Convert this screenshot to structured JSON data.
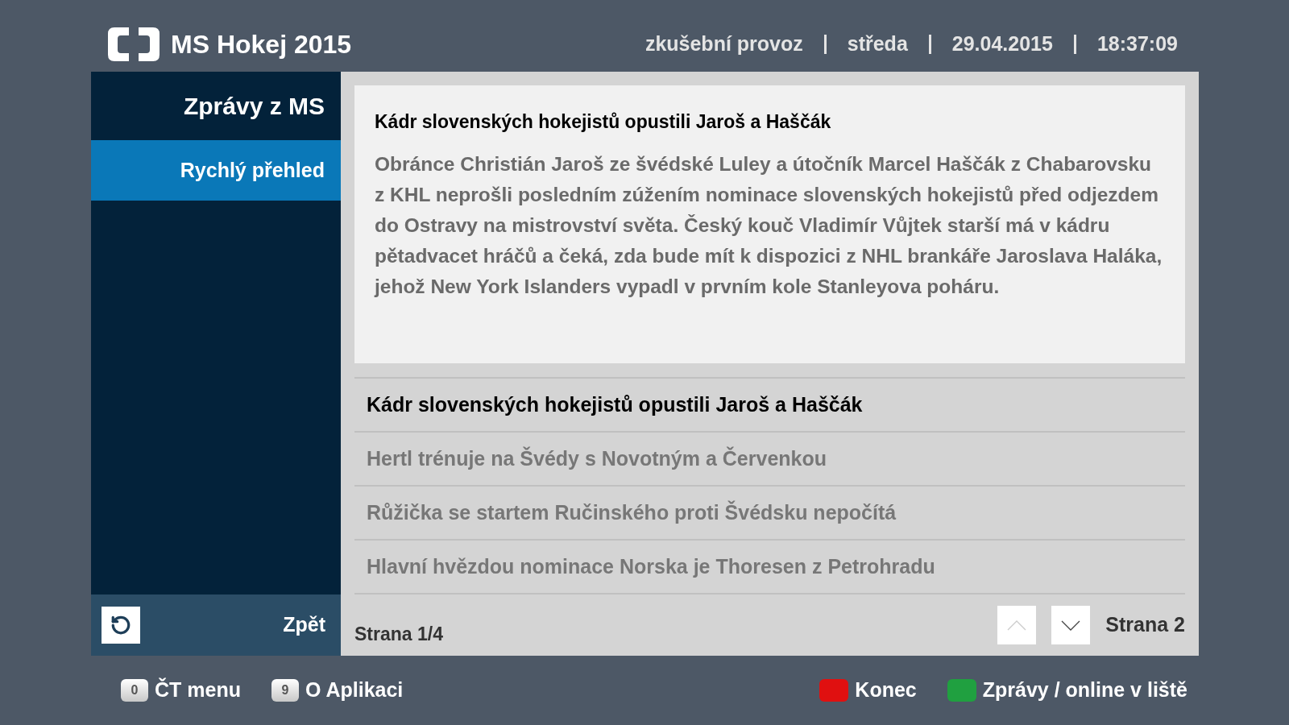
{
  "header": {
    "title": "MS Hokej 2015",
    "status": [
      "zkušební provoz",
      "středa",
      "29.04.2015",
      "18:37:09"
    ]
  },
  "sidebar": {
    "title": "Zprávy z MS",
    "items": [
      {
        "label": "Rychlý přehled",
        "selected": true
      }
    ],
    "back": {
      "label": "Zpět"
    }
  },
  "article": {
    "title": "Kádr slovenských hokejistů opustili Jaroš a Haščák",
    "body": "Obránce Christián Jaroš ze švédské Luley a útočník Marcel Haščák z Chabarovsku z KHL neprošli posledním zúžením nominace slovenských hokejistů před odjezdem do Ostravy na mistrovství světa. Český kouč Vladimír Vůjtek starší má v kádru pětadvacet hráčů a čeká, zda bude mít k dispozici z NHL brankáře Jaroslava Haláka, jehož New York Islanders vypadl v prvním kole Stanleyova poháru."
  },
  "headlines": [
    {
      "label": "Kádr slovenských hokejistů opustili Jaroš a Haščák",
      "selected": true
    },
    {
      "label": "Hertl trénuje na Švédy s Novotným a Červenkou",
      "selected": false
    },
    {
      "label": "Růžička se startem Ručinského proti Švédsku nepočítá",
      "selected": false
    },
    {
      "label": "Hlavní hvězdou nominace Norska je Thoresen z Petrohradu",
      "selected": false
    }
  ],
  "pagination": {
    "page": "Strana 1/4",
    "up_disabled": true,
    "down_disabled": false,
    "next": "Strana 2"
  },
  "footer": [
    {
      "kind": "number",
      "key": "0",
      "label": "ČT menu"
    },
    {
      "kind": "number",
      "key": "9",
      "label": "O Aplikaci"
    },
    {
      "kind": "color",
      "color": "#e01010",
      "label": "Konec"
    },
    {
      "kind": "color",
      "color": "#20a040",
      "label": "Zprávy / online v liště"
    }
  ]
}
